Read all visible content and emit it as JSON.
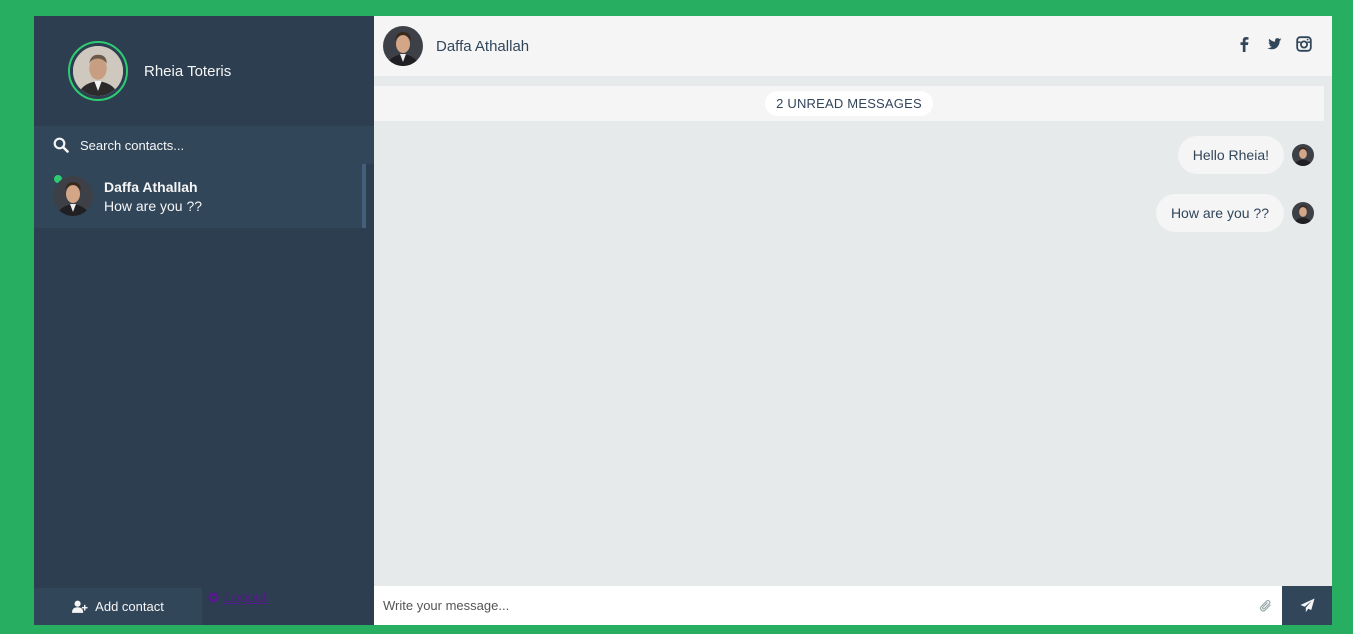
{
  "profile": {
    "name": "Rheia Toteris",
    "status_color": "#2ecc71"
  },
  "search": {
    "placeholder": "Search contacts..."
  },
  "contacts": [
    {
      "name": "Daffa Athallah",
      "preview": "How are you ??",
      "status": "online"
    }
  ],
  "sidebar_bottom": {
    "add_contact_label": "Add contact",
    "logout_label": "Logout"
  },
  "header": {
    "contact_name": "Daffa Athallah",
    "social_icons": [
      "facebook-icon",
      "twitter-icon",
      "instagram-icon"
    ]
  },
  "unread": {
    "label": "2 UNREAD MESSAGES"
  },
  "messages": [
    {
      "text": "Hello Rheia!",
      "direction": "sent"
    },
    {
      "text": "How are you ??",
      "direction": "sent"
    }
  ],
  "composer": {
    "placeholder": "Write your message..."
  },
  "colors": {
    "background": "#27ae60",
    "sidebar": "#2c3e50",
    "panel": "#32465a",
    "chat_bg": "#e6eaea",
    "accent": "#2ecc71"
  }
}
